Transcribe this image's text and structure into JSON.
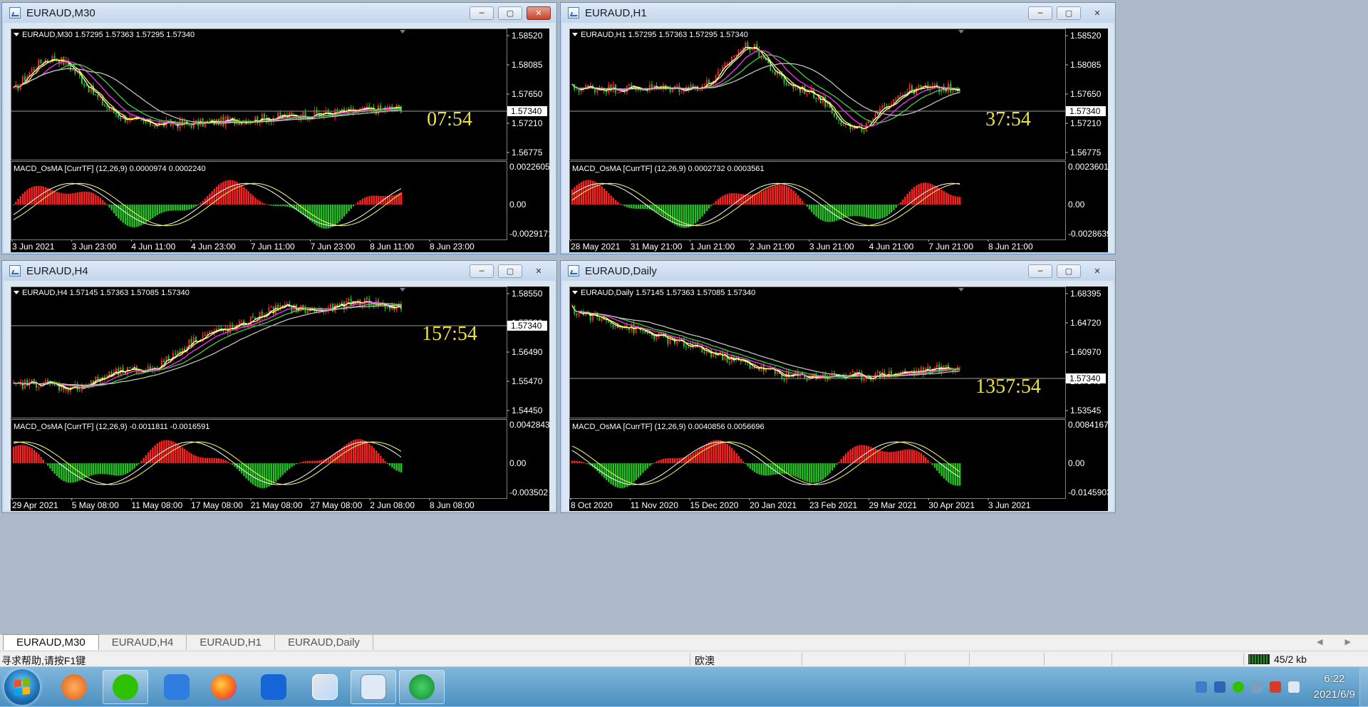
{
  "windows": [
    {
      "id": "m30",
      "title": "EURAUD,M30",
      "ohlc": "EURAUD,M30  1.57295 1.57363 1.57295 1.57340",
      "prices": [
        "1.58520",
        "1.58085",
        "1.57650",
        "1.57210",
        "1.56775"
      ],
      "current_price": "1.57340",
      "countdown": "07:54",
      "macd_label": "MACD_OsMA [CurrTF] (12,26,9) 0.0000974 0.0002240",
      "macd_scale": [
        "0.0022605",
        "0.00",
        "-0.0029171"
      ],
      "time_labels": [
        "3 Jun 2021",
        "3 Jun 23:00",
        "4 Jun 11:00",
        "4 Jun 23:00",
        "7 Jun 11:00",
        "7 Jun 23:00",
        "8 Jun 11:00",
        "8 Jun 23:00"
      ],
      "closed_button_style": "red"
    },
    {
      "id": "h1",
      "title": "EURAUD,H1",
      "ohlc": "EURAUD,H1  1.57295 1.57363 1.57295 1.57340",
      "prices": [
        "1.58520",
        "1.58085",
        "1.57650",
        "1.57210",
        "1.56775"
      ],
      "current_price": "1.57340",
      "countdown": "37:54",
      "macd_label": "MACD_OsMA [CurrTF] (12,26,9) 0.0002732 0.0003561",
      "macd_scale": [
        "0.0023601",
        "0.00",
        "-0.0028639"
      ],
      "time_labels": [
        "28 May 2021",
        "31 May 21:00",
        "1 Jun 21:00",
        "2 Jun 21:00",
        "3 Jun 21:00",
        "4 Jun 21:00",
        "7 Jun 21:00",
        "8 Jun 21:00"
      ],
      "closed_button_style": "plain"
    },
    {
      "id": "h4",
      "title": "EURAUD,H4",
      "ohlc": "EURAUD,H4  1.57145 1.57363 1.57085 1.57340",
      "prices": [
        "1.58550",
        "1.57530",
        "1.56490",
        "1.55470",
        "1.54450"
      ],
      "current_price": "1.57340",
      "countdown": "157:54",
      "macd_label": "MACD_OsMA [CurrTF] (12,26,9) -0.0011811 -0.0016591",
      "macd_scale": [
        "0.0042843",
        "0.00",
        "-0.003502"
      ],
      "time_labels": [
        "29 Apr 2021",
        "5 May 08:00",
        "11 May 08:00",
        "17 May 08:00",
        "21 May 08:00",
        "27 May 08:00",
        "2 Jun 08:00",
        "8 Jun 08:00"
      ],
      "closed_button_style": "plain"
    },
    {
      "id": "daily",
      "title": "EURAUD,Daily",
      "ohlc": "EURAUD,Daily  1.57145 1.57363 1.57085 1.57340",
      "prices": [
        "1.68395",
        "1.64720",
        "1.60970",
        "1.57340",
        "1.53545"
      ],
      "current_price": "1.57340",
      "countdown": "1357:54",
      "macd_label": "MACD_OsMA [CurrTF] (12,26,9) 0.0040856 0.0056696",
      "macd_scale": [
        "0.0084167",
        "0.00",
        "-0.0145903"
      ],
      "time_labels": [
        "8 Oct 2020",
        "11 Nov 2020",
        "15 Dec 2020",
        "20 Jan 2021",
        "23 Feb 2021",
        "29 Mar 2021",
        "30 Apr 2021",
        "3 Jun 2021"
      ],
      "closed_button_style": "plain"
    }
  ],
  "window_controls": {
    "minimize": "─",
    "restore": "▢",
    "close": "✕"
  },
  "tabs": [
    "EURAUD,M30",
    "EURAUD,H4",
    "EURAUD,H1",
    "EURAUD,Daily"
  ],
  "active_tab": "EURAUD,M30",
  "tab_arrows": "◀ ▶",
  "status": {
    "help": "寻求帮助,请按F1键",
    "lang": "欧澳",
    "kb": "45/2 kb"
  },
  "taskbar": {
    "apps": [
      "start",
      "refresh-app",
      "wechat",
      "notes-app",
      "firefox",
      "lark",
      "maps-app",
      "broker-app",
      "green-app"
    ],
    "time": "6:22",
    "date": "2021/6/9"
  },
  "colors": {
    "chart_bg": "#000000",
    "axis_text": "#ffffff",
    "bull": "#ff2020",
    "bear": "#22c322",
    "countdown": "#f0e040",
    "ma_white": "#ffffff",
    "ma_yellow": "#ffff40",
    "ma_magenta": "#ff30ff",
    "ma_green": "#40d040",
    "ma_gray": "#c0c0c0"
  }
}
